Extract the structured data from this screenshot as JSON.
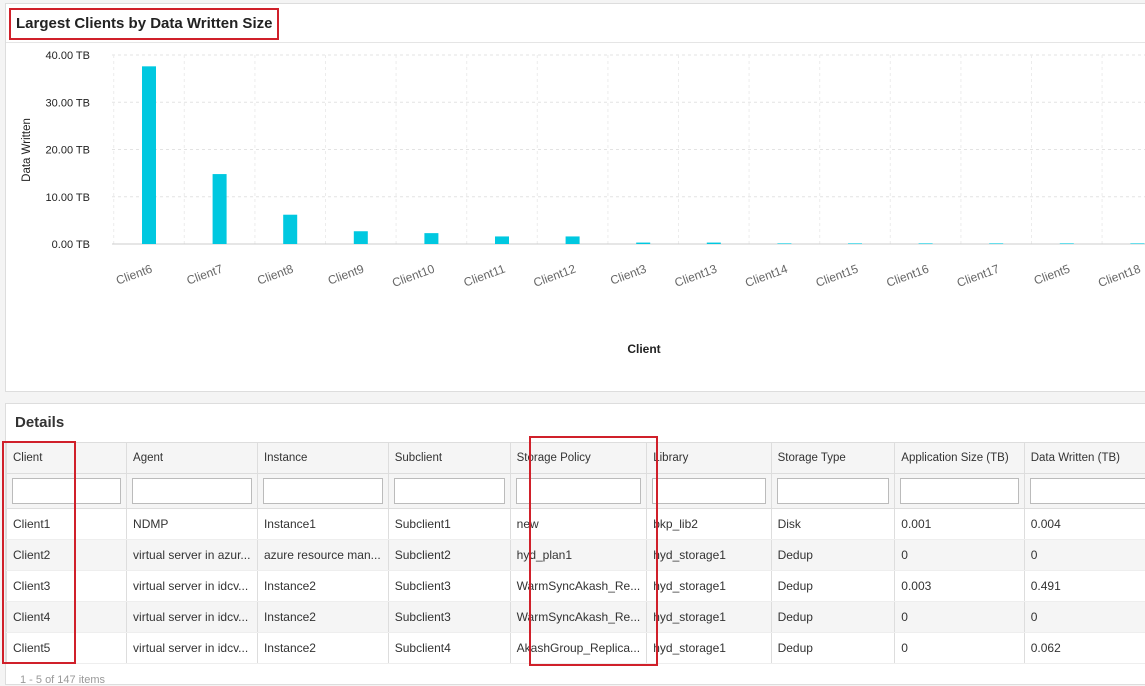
{
  "chart_panel": {
    "title": "Largest Clients by Data Written Size"
  },
  "chart_data": {
    "type": "bar",
    "title": "Largest Clients by Data Written Size",
    "xlabel": "Client",
    "ylabel": "Data Written",
    "unit": "TB",
    "categories": [
      "Client6",
      "Client7",
      "Client8",
      "Client9",
      "Client10",
      "Client11",
      "Client12",
      "Client3",
      "Client13",
      "Client14",
      "Client15",
      "Client16",
      "Client17",
      "Client5",
      "Client18"
    ],
    "values": [
      37.6,
      14.8,
      6.2,
      2.7,
      2.3,
      1.6,
      1.6,
      0.3,
      0.3,
      0.02,
      0.02,
      0.02,
      0.02,
      0.062,
      0.01
    ],
    "ylim": [
      0,
      40
    ],
    "yticks": [
      0,
      10,
      20,
      30,
      40
    ],
    "ytick_labels": [
      "0.00 TB",
      "10.00 TB",
      "20.00 TB",
      "30.00 TB",
      "40.00 TB"
    ],
    "grid": true,
    "bar_color": "#00c8e0"
  },
  "details": {
    "title": "Details",
    "columns": [
      "Client",
      "Agent",
      "Instance",
      "Subclient",
      "Storage Policy",
      "Library",
      "Storage Type",
      "Application Size (TB)",
      "Data Written (TB)"
    ],
    "rows": [
      [
        "Client1",
        "NDMP",
        "Instance1",
        "Subclient1",
        "new",
        "bkp_lib2",
        "Disk",
        "0.001",
        "0.004"
      ],
      [
        "Client2",
        "virtual server in azur...",
        "azure resource man...",
        "Subclient2",
        "hyd_plan1",
        "hyd_storage1",
        "Dedup",
        "0",
        "0"
      ],
      [
        "Client3",
        "virtual server in idcv...",
        "Instance2",
        "Subclient3",
        "WarmSyncAkash_Re...",
        "hyd_storage1",
        "Dedup",
        "0.003",
        "0.491"
      ],
      [
        "Client4",
        "virtual server in idcv...",
        "Instance2",
        "Subclient3",
        "WarmSyncAkash_Re...",
        "hyd_storage1",
        "Dedup",
        "0",
        "0"
      ],
      [
        "Client5",
        "virtual server in idcv...",
        "Instance2",
        "Subclient4",
        "AkashGroup_Replica...",
        "hyd_storage1",
        "Dedup",
        "0",
        "0.062"
      ]
    ],
    "pager": "1 - 5 of 147 items"
  },
  "highlight_color": "#d0202a"
}
